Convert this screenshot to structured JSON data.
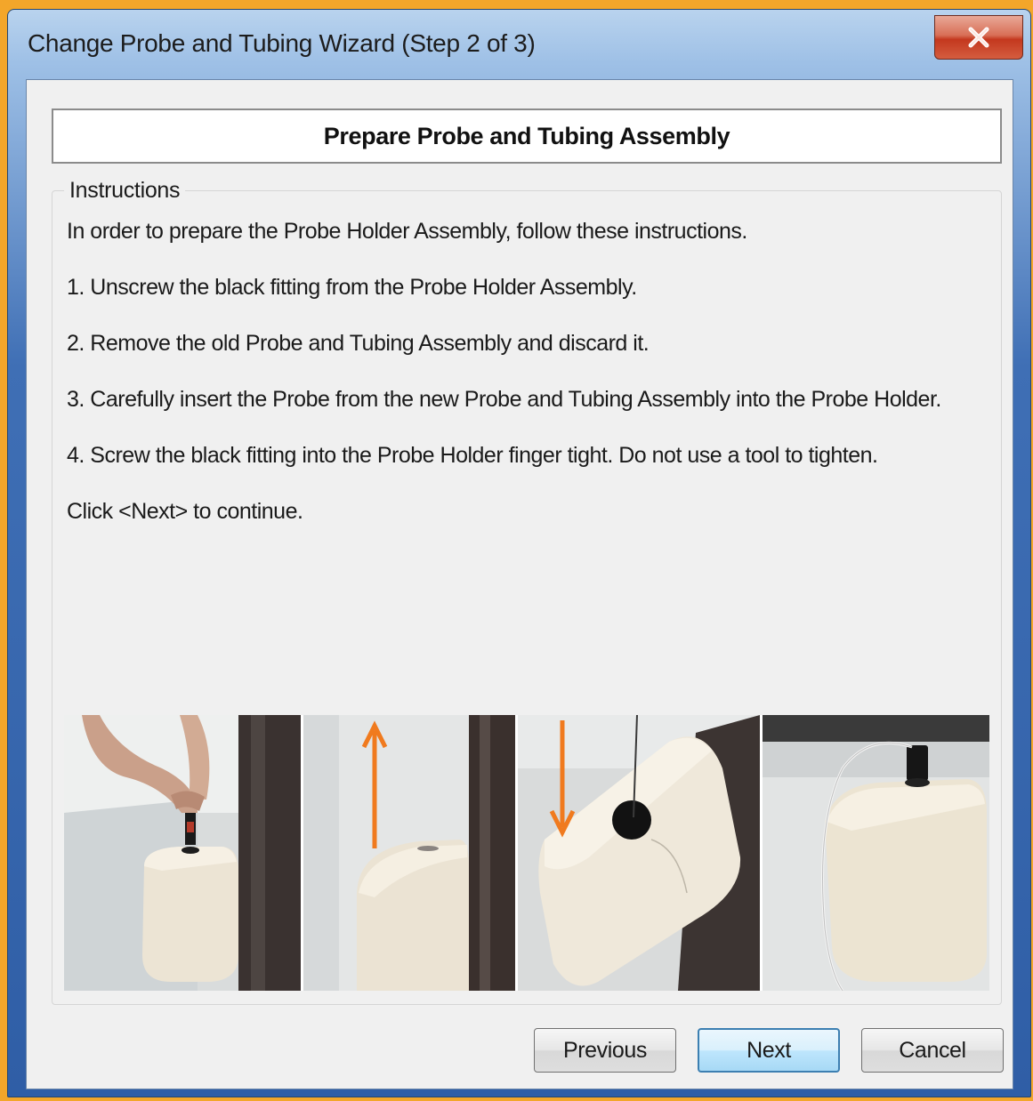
{
  "window": {
    "title": "Change Probe and Tubing Wizard (Step 2 of 3)",
    "close_icon": "close-icon"
  },
  "header": {
    "title": "Prepare Probe and Tubing Assembly"
  },
  "instructions": {
    "legend": "Instructions",
    "intro": "In order to prepare the Probe Holder Assembly, follow these instructions.",
    "steps": [
      "1. Unscrew the black fitting from the Probe Holder Assembly.",
      "2. Remove the old Probe and Tubing Assembly and discard it.",
      "3. Carefully insert the Probe from the new Probe and Tubing Assembly into the Probe Holder.",
      "4. Screw the black fitting into the Probe Holder finger tight. Do not use a tool to tighten."
    ],
    "footer": "Click <Next> to continue."
  },
  "buttons": {
    "previous": "Previous",
    "next": "Next",
    "cancel": "Cancel"
  },
  "colors": {
    "arrow": "#f07a1e",
    "title_frame": "#3f6fb5",
    "default_button_border": "#3c7fb1"
  }
}
